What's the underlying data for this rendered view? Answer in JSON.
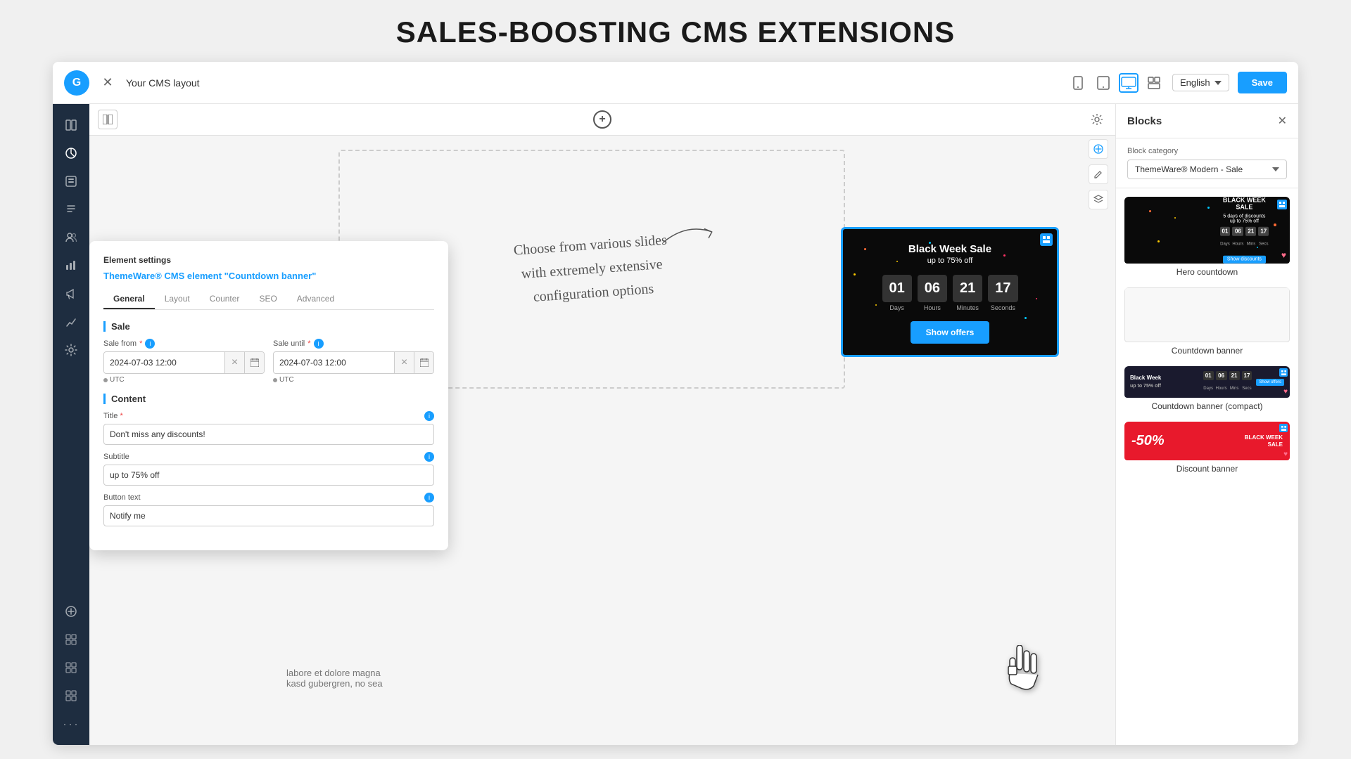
{
  "page": {
    "title": "SALES-BOOSTING CMS EXTENSIONS"
  },
  "topbar": {
    "logo_text": "G",
    "close_label": "×",
    "layout_title": "Your CMS layout",
    "language": "English",
    "save_label": "Save"
  },
  "device_icons": [
    {
      "name": "mobile-icon",
      "label": "📱"
    },
    {
      "name": "tablet-icon",
      "label": "💻"
    },
    {
      "name": "desktop-icon",
      "label": "🖥",
      "active": true
    },
    {
      "name": "layout-icon",
      "label": "▦"
    }
  ],
  "sidebar": {
    "icons": [
      {
        "name": "dashboard-icon",
        "symbol": "◎"
      },
      {
        "name": "pages-icon",
        "symbol": "⊞"
      },
      {
        "name": "content-icon",
        "symbol": "📄"
      },
      {
        "name": "users-icon",
        "symbol": "👥"
      },
      {
        "name": "marketing-icon",
        "symbol": "📊"
      },
      {
        "name": "analytics-icon",
        "symbol": "⟳"
      },
      {
        "name": "settings-icon",
        "symbol": "⚙"
      },
      {
        "name": "plugins-icon",
        "symbol": "⊕"
      },
      {
        "name": "table1-icon",
        "symbol": "▦"
      },
      {
        "name": "table2-icon",
        "symbol": "▦"
      },
      {
        "name": "table3-icon",
        "symbol": "▦"
      },
      {
        "name": "table4-icon",
        "symbol": "▦"
      }
    ]
  },
  "canvas": {
    "handwritten_text": "Choose from various slides\nwith extremely extensive\nconfiguration options",
    "add_button_label": "+"
  },
  "countdown_banner": {
    "title": "Black Week Sale",
    "subtitle": "up to 75% off",
    "days_label": "Days",
    "hours_label": "Hours",
    "minutes_label": "Minutes",
    "seconds_label": "Seconds",
    "days_value": "01",
    "hours_value": "06",
    "minutes_value": "21",
    "seconds_value": "17",
    "button_label": "Show offers"
  },
  "element_settings": {
    "panel_title": "Element settings",
    "element_title": "ThemeWare® CMS element \"Countdown banner\"",
    "tabs": [
      "General",
      "Layout",
      "Counter",
      "SEO",
      "Advanced"
    ],
    "active_tab": "General",
    "sections": {
      "sale": {
        "title": "Sale",
        "sale_from_label": "Sale from",
        "sale_until_label": "Sale until",
        "sale_from_value": "2024-07-03 12:00",
        "sale_until_value": "2024-07-03 12:00",
        "utc_label": "UTC"
      },
      "content": {
        "title": "Content",
        "title_label": "Title",
        "title_value": "Don't miss any discounts!",
        "subtitle_label": "Subtitle",
        "subtitle_value": "up to 75% off",
        "button_text_label": "Button text",
        "button_text_value": "Notify me"
      }
    }
  },
  "right_panel": {
    "title": "Blocks",
    "close_label": "×",
    "category_label": "Block category",
    "category_value": "ThemeWare® Modern - Sale",
    "blocks": [
      {
        "id": "hero-countdown",
        "label": "Hero countdown",
        "type": "hero"
      },
      {
        "id": "countdown-banner",
        "label": "Countdown banner",
        "type": "countdown"
      },
      {
        "id": "countdown-banner-compact",
        "label": "Countdown banner (compact)",
        "type": "compact"
      },
      {
        "id": "discount-banner",
        "label": "Discount banner",
        "type": "discount"
      }
    ]
  }
}
